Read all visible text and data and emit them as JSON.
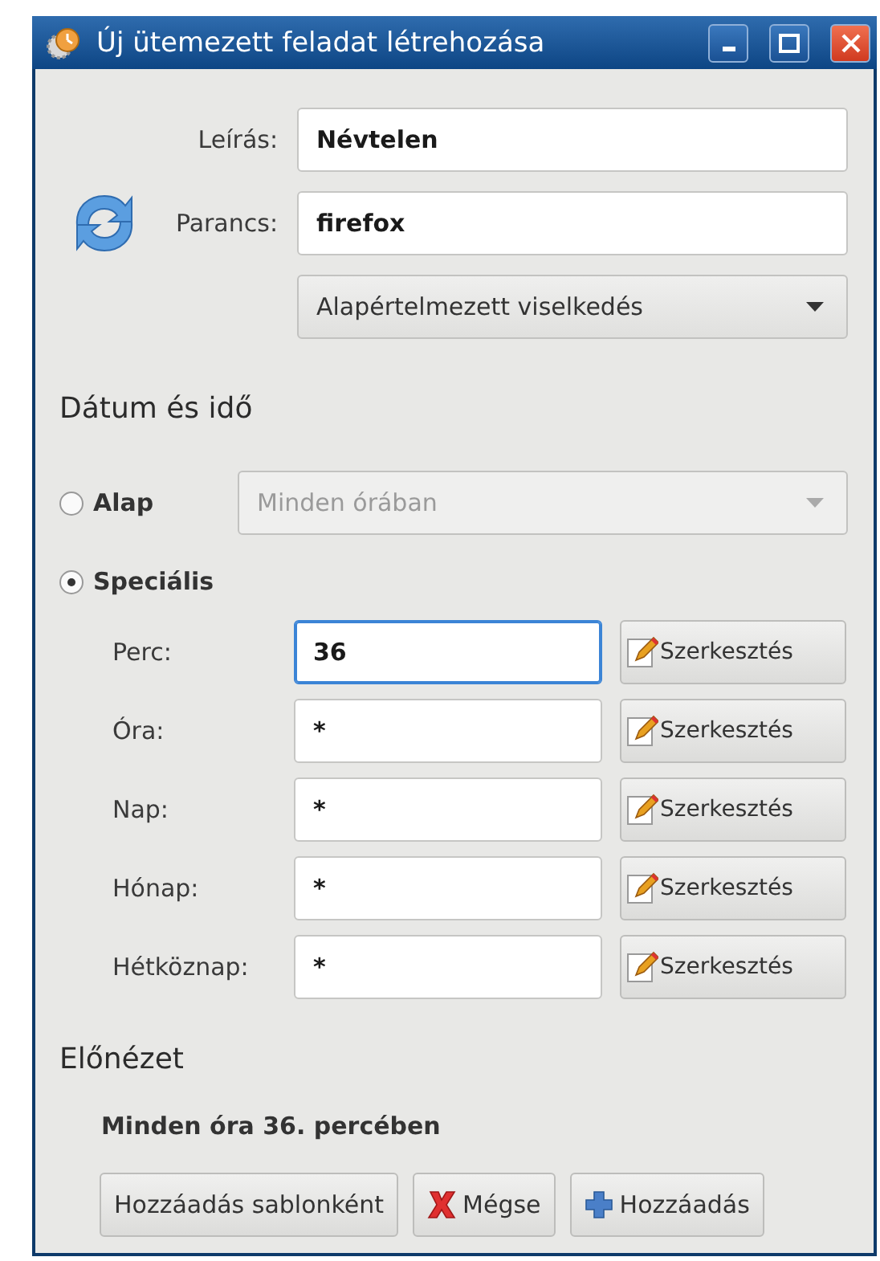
{
  "window": {
    "title": "Új ütemezett feladat létrehozása"
  },
  "description": {
    "label": "Leírás:",
    "value": "Névtelen"
  },
  "command": {
    "label": "Parancs:",
    "value": "firefox"
  },
  "behavior": {
    "value": "Alapértelmezett viselkedés"
  },
  "date_time": {
    "heading": "Dátum és idő",
    "modes": [
      {
        "label": "Alap",
        "selected": false,
        "kind": "preset",
        "value": "Minden órában",
        "disabled": true
      },
      {
        "label": "Speciális",
        "selected": true,
        "kind": "custom"
      }
    ],
    "fields": [
      {
        "label": "Perc:",
        "value": "36",
        "focused": true,
        "button": "Szerkesztés"
      },
      {
        "label": "Óra:",
        "value": "*",
        "focused": false,
        "button": "Szerkesztés"
      },
      {
        "label": "Nap:",
        "value": "*",
        "focused": false,
        "button": "Szerkesztés"
      },
      {
        "label": "Hónap:",
        "value": "*",
        "focused": false,
        "button": "Szerkesztés"
      },
      {
        "label": "Hétköznap:",
        "value": "*",
        "focused": false,
        "button": "Szerkesztés"
      }
    ]
  },
  "preview": {
    "heading": "Előnézet",
    "text": "Minden óra 36. percében"
  },
  "buttons": [
    {
      "label": "Hozzáadás sablonként",
      "kind": "template"
    },
    {
      "label": "Mégse",
      "kind": "cancel"
    },
    {
      "label": "Hozzáadás",
      "kind": "add"
    }
  ]
}
